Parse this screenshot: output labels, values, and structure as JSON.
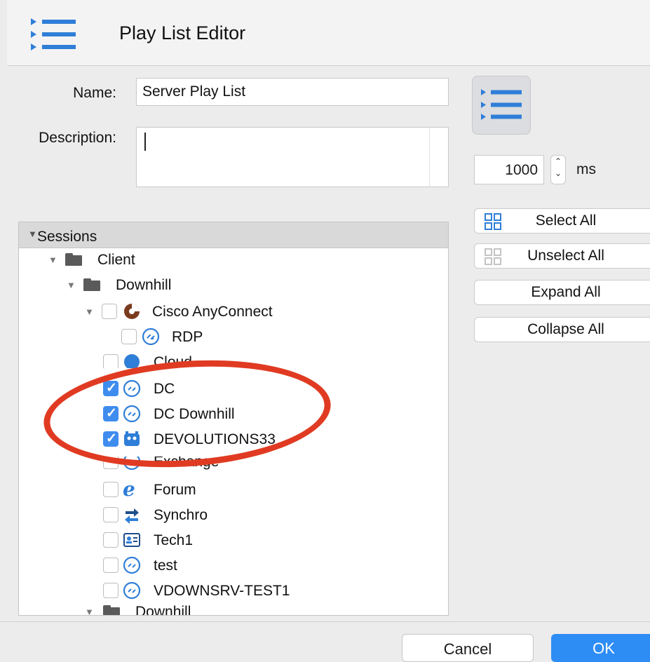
{
  "window": {
    "title": "Play List Editor"
  },
  "form": {
    "name_label": "Name:",
    "name_value": "Server Play List",
    "description_label": "Description:",
    "description_value": ""
  },
  "interval": {
    "value": "1000",
    "unit": "ms"
  },
  "actions": {
    "select_all": "Select All",
    "unselect_all": "Unselect All",
    "expand_all": "Expand All",
    "collapse_all": "Collapse All"
  },
  "tree": {
    "header": "Sessions",
    "rows": [
      {
        "label": "Client",
        "type": "folder",
        "checked": false
      },
      {
        "label": "Downhill",
        "type": "folder",
        "checked": false
      },
      {
        "label": "Cisco AnyConnect",
        "type": "session",
        "icon": "cisco-anyconnect-icon",
        "checked": false
      },
      {
        "label": "RDP",
        "type": "session",
        "icon": "rdp-icon",
        "checked": false
      },
      {
        "label": "Cloud",
        "type": "session",
        "icon": "cloud-icon",
        "checked": false
      },
      {
        "label": "DC",
        "type": "session",
        "icon": "rdp-icon",
        "checked": true
      },
      {
        "label": "DC Downhill",
        "type": "session",
        "icon": "rdp-icon",
        "checked": true
      },
      {
        "label": "DEVOLUTIONS33",
        "type": "session",
        "icon": "devolutions-icon",
        "checked": true
      },
      {
        "label": "Exchange",
        "type": "session",
        "icon": "web-icon",
        "checked": false
      },
      {
        "label": "Forum",
        "type": "session",
        "icon": "internet-explorer-icon",
        "checked": false
      },
      {
        "label": "Synchro",
        "type": "session",
        "icon": "sync-arrows-icon",
        "checked": false
      },
      {
        "label": "Tech1",
        "type": "session",
        "icon": "contact-card-icon",
        "checked": false
      },
      {
        "label": "test",
        "type": "session",
        "icon": "rdp-icon",
        "checked": false
      },
      {
        "label": "VDOWNSRV-TEST1",
        "type": "session",
        "icon": "rdp-icon",
        "checked": false
      },
      {
        "label": "Downhill",
        "type": "folder",
        "checked": false
      }
    ]
  },
  "footer": {
    "cancel": "Cancel",
    "ok": "OK"
  },
  "colors": {
    "accent": "#2e8df5",
    "icon_blue": "#2f7ed8",
    "highlight_red": "#e03b22"
  }
}
